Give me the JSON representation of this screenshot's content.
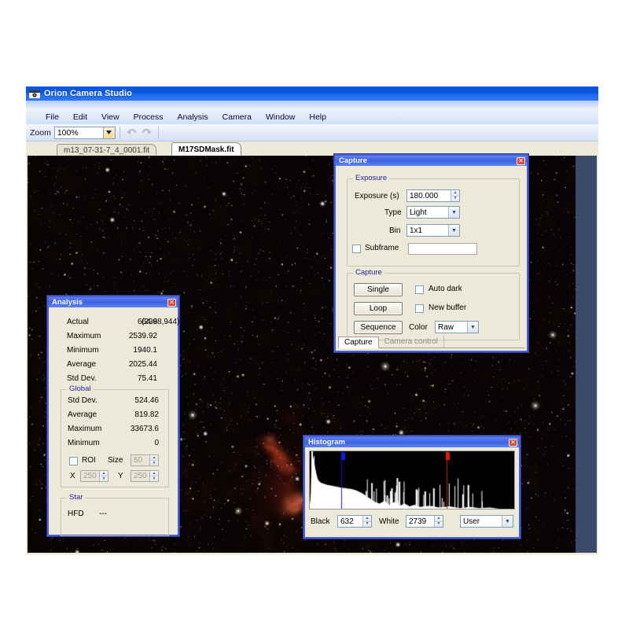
{
  "app": {
    "title": "Orion Camera Studio",
    "icon": "camera-icon",
    "menu": [
      "File",
      "Edit",
      "View",
      "Process",
      "Analysis",
      "Camera",
      "Window",
      "Help"
    ],
    "toolbar": {
      "zoom_label": "Zoom",
      "zoom_value": "100%",
      "undo_icon": "undo-icon",
      "redo_icon": "redo-icon"
    },
    "tabs": [
      {
        "label": "m13_07-31-7_4_0001.fit",
        "active": false
      },
      {
        "label": "M17SDMask.fit",
        "active": true
      }
    ]
  },
  "capture": {
    "title": "Capture",
    "close_icon": "close-icon",
    "exposure_group": "Exposure",
    "exposure_label": "Exposure (s)",
    "exposure_value": "180.000",
    "type_label": "Type",
    "type_value": "Light",
    "bin_label": "Bin",
    "bin_value": "1x1",
    "subframe_label": "Subframe",
    "subframe_checked": false,
    "subframe_value": "",
    "capture_group": "Capture",
    "single_label": "Single",
    "loop_label": "Loop",
    "sequence_label": "Sequence",
    "auto_dark_label": "Auto dark",
    "auto_dark_checked": false,
    "new_buffer_label": "New buffer",
    "new_buffer_checked": false,
    "color_label": "Color",
    "color_value": "Raw",
    "tabs": [
      {
        "label": "Capture",
        "active": true
      },
      {
        "label": "Camera control",
        "active": false
      }
    ]
  },
  "analysis": {
    "title": "Analysis",
    "close_icon": "close-icon",
    "rows": [
      {
        "label": "Actual",
        "value": "664.9",
        "extra": "(2988,944)"
      },
      {
        "label": "Maximum",
        "value": "2539.92",
        "extra": ""
      },
      {
        "label": "Minimum",
        "value": "1940.1",
        "extra": ""
      },
      {
        "label": "Average",
        "value": "2025.44",
        "extra": ""
      },
      {
        "label": "Std Dev.",
        "value": "75.41",
        "extra": ""
      }
    ],
    "global_group": "Global",
    "global_rows": [
      {
        "label": "Std Dev.",
        "value": "524.46"
      },
      {
        "label": "Average",
        "value": "819.82"
      },
      {
        "label": "Maximum",
        "value": "33673.6"
      },
      {
        "label": "Minimum",
        "value": "0"
      }
    ],
    "roi_label": "ROI",
    "roi_checked": false,
    "size_label": "Size",
    "size_value": "50",
    "x_label": "X",
    "x_value": "250",
    "y_label": "Y",
    "y_value": "250",
    "star_group": "Star",
    "hfd_label": "HFD",
    "hfd_value": "---"
  },
  "histogram": {
    "title": "Histogram",
    "close_icon": "close-icon",
    "black_label": "Black",
    "black_value": "632",
    "white_label": "White",
    "white_value": "2739",
    "mode_value": "User",
    "black_marker_color": "#1414e0",
    "white_marker_color": "#e01414"
  },
  "colors": {
    "title_blue": "#0b54e0",
    "dialog_border": "#4a5fd0",
    "mdi_background": "#3b4a6b",
    "face": "#ece9d8",
    "group_caption": "#23239c"
  },
  "chart_data": {
    "type": "area",
    "title": "Histogram",
    "xlabel": "",
    "ylabel": "",
    "inverted": true,
    "xlim": [
      0,
      4095
    ],
    "black_point": 632,
    "white_point": 2739,
    "note": "Image intensity histogram rendered white-on-black; sharply peaked near the low end with a long descending tail of sparse spikes.",
    "x": [
      0,
      10,
      20,
      30,
      40,
      50,
      60,
      70,
      80,
      90,
      100,
      110,
      120,
      130,
      140,
      150,
      160,
      170,
      180,
      190,
      200,
      215,
      230,
      245,
      260,
      275,
      290,
      305,
      320,
      340,
      360,
      380,
      400,
      420,
      440,
      460,
      480,
      500,
      520,
      540,
      560,
      580,
      600,
      640,
      680,
      720,
      760,
      800,
      850,
      900,
      950,
      1000,
      1050,
      1100,
      1150,
      1200,
      1250,
      1300,
      1400,
      1500,
      1600,
      1700,
      1800,
      1900,
      2000,
      2100,
      2200,
      2400,
      2600,
      2800,
      3000,
      3200,
      3400,
      3600,
      3800,
      4000
    ],
    "y": [
      8,
      14,
      30,
      62,
      100,
      96,
      92,
      88,
      84,
      80,
      76,
      70,
      66,
      62,
      58,
      55,
      52,
      50,
      49,
      48,
      47,
      46,
      45,
      45,
      44,
      44,
      43,
      43,
      42,
      42,
      41,
      41,
      41,
      40,
      40,
      40,
      39,
      39,
      39,
      38,
      38,
      38,
      37,
      37,
      36,
      36,
      35,
      35,
      34,
      33,
      31,
      29,
      27,
      24,
      21,
      18,
      15,
      12,
      9,
      14,
      6,
      12,
      5,
      9,
      4,
      7,
      3,
      5,
      2,
      4,
      1,
      3,
      1,
      2,
      0,
      0
    ]
  }
}
